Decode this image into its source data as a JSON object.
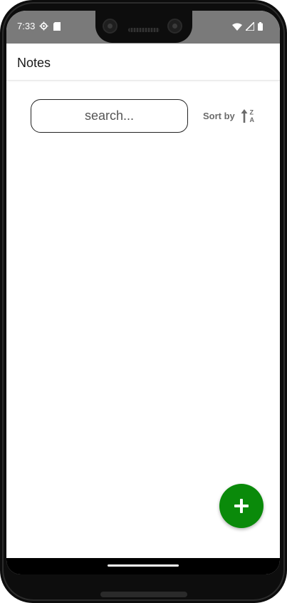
{
  "status_bar": {
    "time": "7:33",
    "left_icons": [
      "settings-icon",
      "sd-card-icon"
    ],
    "right_icons": [
      "wifi-icon",
      "signal-icon",
      "battery-icon"
    ],
    "background": "#7a7a7a"
  },
  "app_bar": {
    "title": "Notes"
  },
  "search": {
    "placeholder": "search...",
    "value": ""
  },
  "sort": {
    "label": "Sort by",
    "icon": "sort-z-a-icon",
    "icon_letters": [
      "Z",
      "A"
    ]
  },
  "fab": {
    "icon": "plus-icon",
    "color": "#0a8a0a"
  }
}
